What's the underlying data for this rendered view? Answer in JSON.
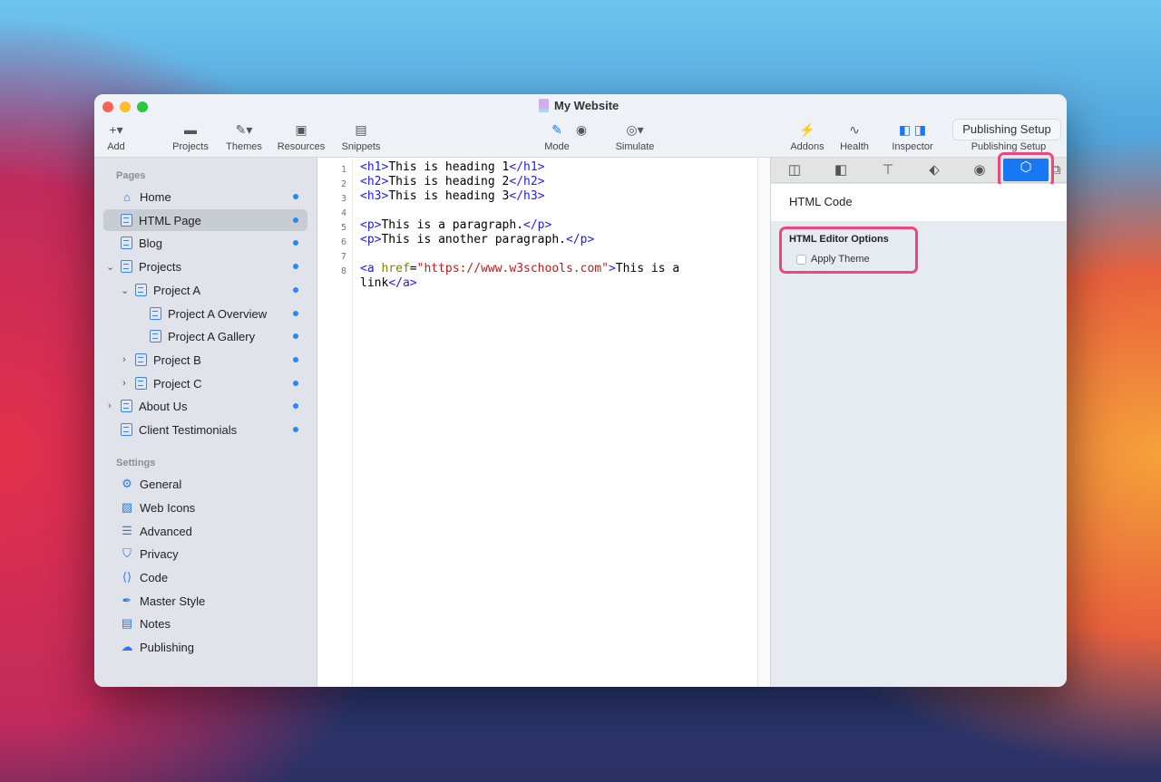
{
  "window": {
    "title": "My Website"
  },
  "toolbar": {
    "add": "Add",
    "projects": "Projects",
    "themes": "Themes",
    "resources": "Resources",
    "snippets": "Snippets",
    "mode": "Mode",
    "simulate": "Simulate",
    "addons": "Addons",
    "health": "Health",
    "inspector": "Inspector",
    "publishing_setup_button": "Publishing Setup",
    "publishing_setup": "Publishing Setup"
  },
  "sidebar": {
    "pages_header": "Pages",
    "pages": [
      {
        "label": "Home"
      },
      {
        "label": "HTML Page"
      },
      {
        "label": "Blog"
      },
      {
        "label": "Projects"
      },
      {
        "label": "Project A"
      },
      {
        "label": "Project A Overview"
      },
      {
        "label": "Project A Gallery"
      },
      {
        "label": "Project B"
      },
      {
        "label": "Project C"
      },
      {
        "label": "About Us"
      },
      {
        "label": "Client Testimonials"
      }
    ],
    "settings_header": "Settings",
    "settings": [
      {
        "label": "General"
      },
      {
        "label": "Web Icons"
      },
      {
        "label": "Advanced"
      },
      {
        "label": "Privacy"
      },
      {
        "label": "Code"
      },
      {
        "label": "Master Style"
      },
      {
        "label": "Notes"
      },
      {
        "label": "Publishing"
      }
    ]
  },
  "editor": {
    "line_numbers": [
      "1",
      "2",
      "3",
      "4",
      "5",
      "6",
      "7",
      "8"
    ],
    "lines": [
      [
        [
          "t",
          "<h1>"
        ],
        [
          "x",
          "This is heading 1"
        ],
        [
          "t",
          "</h1>"
        ]
      ],
      [
        [
          "t",
          "<h2>"
        ],
        [
          "x",
          "This is heading 2"
        ],
        [
          "t",
          "</h2>"
        ]
      ],
      [
        [
          "t",
          "<h3>"
        ],
        [
          "x",
          "This is heading 3"
        ],
        [
          "t",
          "</h3>"
        ]
      ],
      [],
      [
        [
          "t",
          "<p>"
        ],
        [
          "x",
          "This is a paragraph."
        ],
        [
          "t",
          "</p>"
        ]
      ],
      [
        [
          "t",
          "<p>"
        ],
        [
          "x",
          "This is another paragraph."
        ],
        [
          "t",
          "</p>"
        ]
      ],
      [],
      [
        [
          "t",
          "<a "
        ],
        [
          "a",
          "href"
        ],
        [
          "x",
          "="
        ],
        [
          "s",
          "\"https://www.w3schools.com\""
        ],
        [
          "t",
          ">"
        ],
        [
          "x",
          "This is a"
        ]
      ],
      [
        [
          "x",
          "link"
        ],
        [
          "t",
          "</a>"
        ]
      ]
    ]
  },
  "inspector": {
    "header": "HTML Code",
    "options_title": "HTML Editor Options",
    "apply_theme_label": "Apply Theme",
    "apply_theme_checked": false
  }
}
